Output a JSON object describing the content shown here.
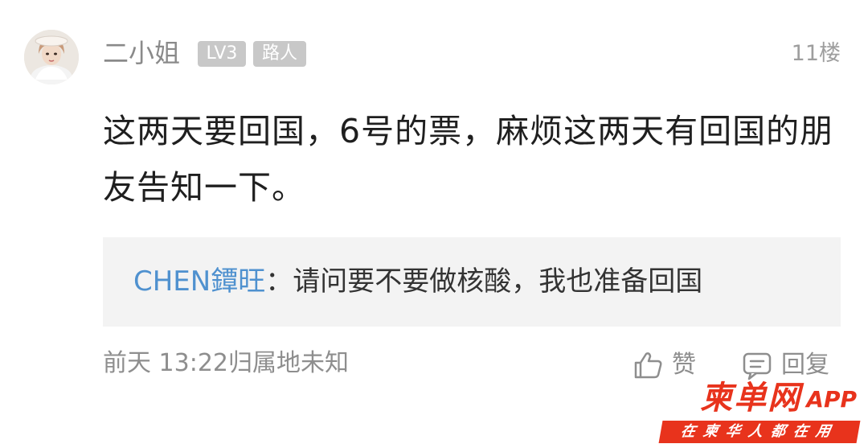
{
  "post": {
    "username": "二小姐",
    "level_badge": "LV3",
    "role_badge": "路人",
    "floor": "11楼",
    "content": "这两天要回国，6号的票，麻烦这两天有回国的朋友告知一下。",
    "quote": {
      "author": "CHEN鐔旺",
      "separator": "：",
      "text": "请问要不要做核酸，我也准备回国"
    },
    "time": "前天 13:22",
    "location": "归属地未知",
    "actions": {
      "like_label": "赞",
      "reply_label": "回复"
    }
  },
  "watermark": {
    "brand": "柬单网",
    "app": "APP",
    "slogan": "在柬华人都在用"
  },
  "colors": {
    "link_blue": "#4f91cf",
    "brand_red": "#e8331c",
    "quote_bg": "#f3f3f3",
    "badge_gray": "#c8c8c8"
  },
  "icons": {
    "like": "thumbs-up-icon",
    "reply": "comment-icon"
  }
}
